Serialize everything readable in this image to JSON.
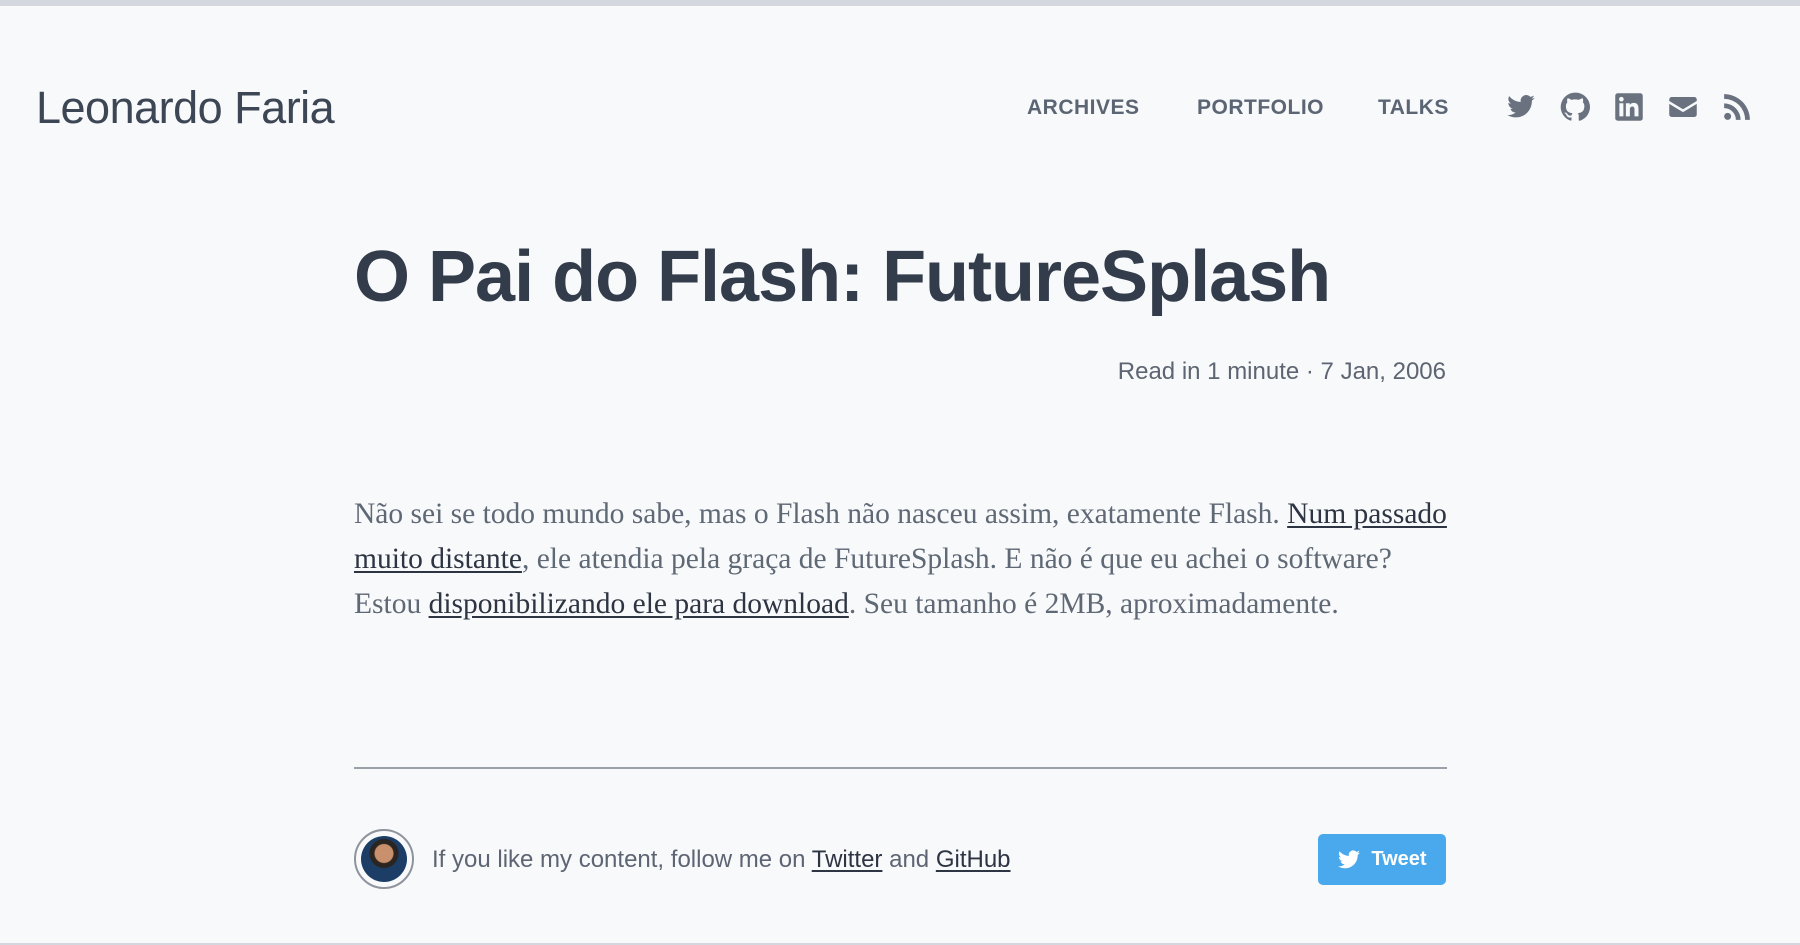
{
  "site": {
    "title": "Leonardo Faria"
  },
  "nav": {
    "items": [
      {
        "label": "ARCHIVES"
      },
      {
        "label": "PORTFOLIO"
      },
      {
        "label": "TALKS"
      }
    ],
    "social_icons": [
      "twitter-icon",
      "github-icon",
      "linkedin-icon",
      "email-icon",
      "rss-icon"
    ]
  },
  "post": {
    "title": "O Pai do Flash: FutureSplash",
    "meta": "Read in 1 minute · 7 Jan, 2006",
    "body": {
      "part1": "Não sei se todo mundo sabe, mas o Flash não nasceu assim, exatamente Flash. ",
      "link1": "Num passado muito distante",
      "part2": ", ele atendia pela graça de FutureSplash. E não é que eu achei o software? Estou ",
      "link2": "disponibilizando ele para download",
      "part3": ". Seu tamanho é 2MB, aproximadamente."
    }
  },
  "footer": {
    "follow_text": "If you like my content, follow me on ",
    "twitter_link": "Twitter",
    "and_text": " and ",
    "github_link": "GitHub",
    "tweet_label": "Tweet"
  },
  "colors": {
    "background": "#f8f9fb",
    "tweet_button": "#4aa8ec",
    "title": "#333c4b"
  }
}
